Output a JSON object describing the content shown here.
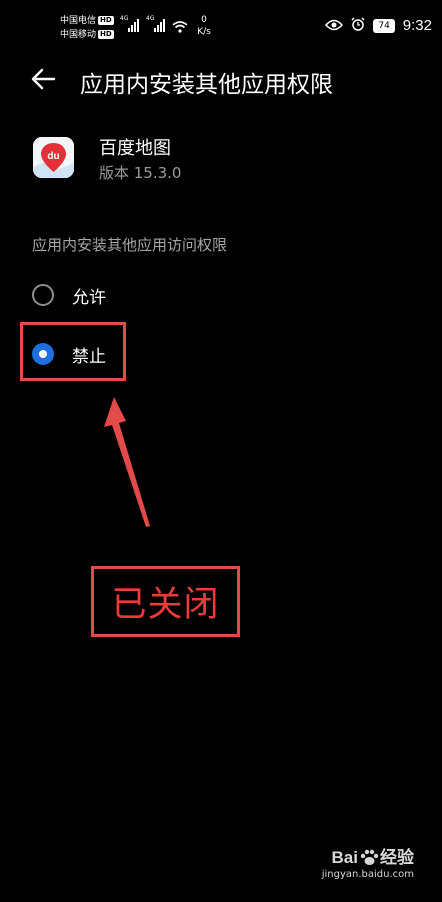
{
  "status_bar": {
    "carrier1": "中国电信",
    "carrier2": "中国移动",
    "hd_badge": "HD",
    "network1": "4G",
    "network2": "4G",
    "speed_value": "0",
    "speed_unit": "K/s",
    "battery": "74",
    "time": "9:32"
  },
  "header": {
    "title": "应用内安装其他应用权限",
    "back_icon": "arrow-left-icon"
  },
  "app": {
    "name": "百度地图",
    "version": "版本 15.3.0",
    "icon_text": "du"
  },
  "section": {
    "title": "应用内安装其他应用访问权限"
  },
  "options": [
    {
      "label": "允许",
      "selected": false
    },
    {
      "label": "禁止",
      "selected": true
    }
  ],
  "annotation": {
    "callout": "已关闭",
    "color": "#e34b4b"
  },
  "watermark": {
    "brand": "Bai",
    "brand2": "经验",
    "url": "jingyan.baidu.com"
  }
}
